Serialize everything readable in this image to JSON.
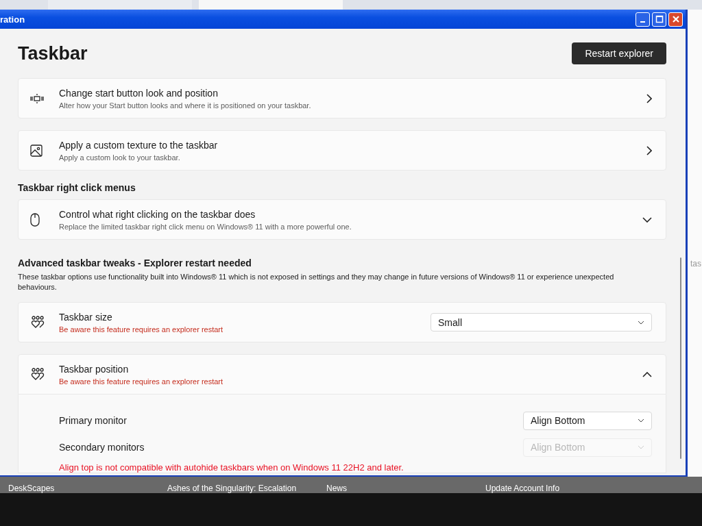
{
  "window": {
    "title": "ration"
  },
  "page_title": "Taskbar",
  "restart_button": "Restart explorer",
  "blocks": [
    {
      "kind": "link",
      "title": "Change start button look and position",
      "subtitle": "Alter how your Start button looks and where it is positioned on your taskbar."
    },
    {
      "kind": "link",
      "title": "Apply a custom texture to the taskbar",
      "subtitle": "Apply a custom look to your taskbar."
    },
    {
      "kind": "heading",
      "title": "Taskbar right click menus"
    },
    {
      "kind": "expander",
      "title": "Control what right clicking on the taskbar does",
      "subtitle": "Replace the limited taskbar right click menu on Windows® 11 with a more powerful one.",
      "expanded": false
    },
    {
      "kind": "section",
      "title": "Advanced taskbar tweaks - Explorer restart needed",
      "description": "These taskbar options use functionality built into Windows® 11 which is not exposed in settings and they may change in future versions of Windows® 11 or experience unexpected behaviours."
    },
    {
      "kind": "dropdown",
      "title": "Taskbar size",
      "warning": "Be aware this feature requires an explorer restart",
      "value": "Small"
    },
    {
      "kind": "expander",
      "title": "Taskbar position",
      "warning": "Be aware this feature requires an explorer restart",
      "expanded": true,
      "rows": [
        {
          "label": "Primary monitor",
          "value": "Align Bottom",
          "disabled": false
        },
        {
          "label": "Secondary monitors",
          "value": "Align Bottom",
          "disabled": true
        }
      ],
      "note": "Align top is not compatible with autohide taskbars when on Windows 11 22H2 and later."
    }
  ],
  "side_window": {
    "text": "tas"
  },
  "bottom_bar": [
    "DeskScapes",
    "Ashes of the Singularity: Escalation",
    "News",
    "Update Account Info"
  ]
}
